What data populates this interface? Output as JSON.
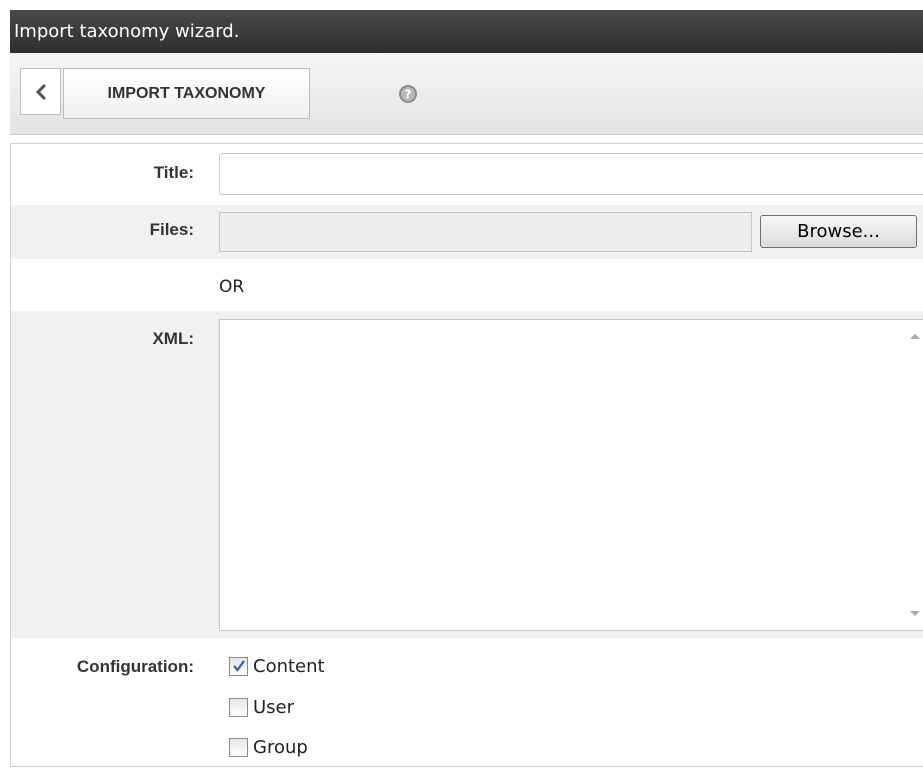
{
  "window": {
    "title": "Import taxonomy wizard."
  },
  "toolbar": {
    "back_icon": "chevron-left-icon",
    "import_label": "IMPORT TAXONOMY",
    "help_icon": "help-icon"
  },
  "form": {
    "title_label": "Title:",
    "title_value": "",
    "files_label": "Files:",
    "files_value": "",
    "browse_label": "Browse...",
    "or_text": "OR",
    "xml_label": "XML:",
    "xml_value": "",
    "configuration_label": "Configuration:",
    "options": [
      {
        "label": "Content",
        "checked": true
      },
      {
        "label": "User",
        "checked": false
      },
      {
        "label": "Group",
        "checked": false
      }
    ]
  },
  "colors": {
    "titlebar": "#3a3a3a",
    "check": "#2f5fb0"
  }
}
